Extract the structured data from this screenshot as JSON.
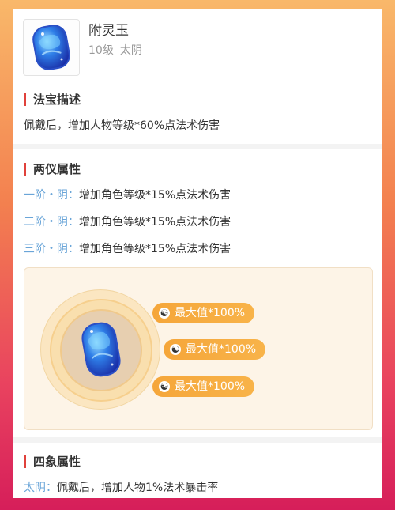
{
  "item": {
    "name": "附灵玉",
    "level": "10级",
    "element": "太阴",
    "icon": "blue-jade-gem-icon"
  },
  "description": {
    "title": "法宝描述",
    "text": "佩戴后，增加人物等级*60%点法术伤害"
  },
  "two_yi": {
    "title": "两仪属性",
    "rows": [
      {
        "label": "一阶・阴",
        "sep": "：",
        "text": "增加角色等级*15%点法术伤害"
      },
      {
        "label": "二阶・阴",
        "sep": "：",
        "text": "增加角色等级*15%点法术伤害"
      },
      {
        "label": "三阶・阴",
        "sep": "：",
        "text": "增加角色等级*15%点法术伤害"
      }
    ],
    "bonuses": [
      {
        "text": "最大值*100%",
        "icon": "yin-yang-icon"
      },
      {
        "text": "最大值*100%",
        "icon": "yin-yang-icon"
      },
      {
        "text": "最大值*100%",
        "icon": "yin-yang-icon"
      }
    ]
  },
  "four_xiang": {
    "title": "四象属性",
    "rows": [
      {
        "label": "太阴",
        "sep": "：",
        "text": "佩戴后，增加人物1%法术暴击率"
      }
    ]
  },
  "colors": {
    "accent": "#e0413b",
    "tier_label": "#6aa5d8",
    "pill": "#f5a63a"
  }
}
